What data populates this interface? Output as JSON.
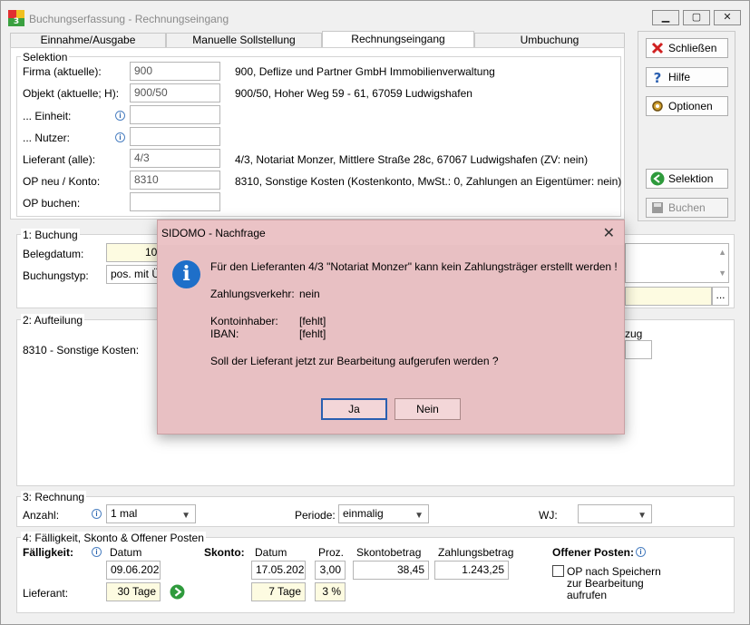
{
  "window": {
    "title": "Buchungserfassung - Rechnungseingang"
  },
  "tabs": [
    "Einnahme/Ausgabe",
    "Manuelle Sollstellung",
    "Rechnungseingang",
    "Umbuchung"
  ],
  "buttons": {
    "close": "Schließen",
    "help": "Hilfe",
    "options": "Optionen",
    "selection": "Selektion",
    "book": "Buchen"
  },
  "selektion": {
    "legend": "Selektion",
    "rows": [
      {
        "label": "Firma (aktuelle):",
        "value": "900",
        "desc": "900,  Deflize und Partner GmbH Immobilienverwaltung"
      },
      {
        "label": "Objekt (aktuelle; H):",
        "value": "900/50",
        "desc": "900/50,  Hoher Weg 59 - 61, 67059 Ludwigshafen"
      },
      {
        "label": "... Einheit:",
        "value": "",
        "desc": ""
      },
      {
        "label": "... Nutzer:",
        "value": "",
        "desc": ""
      },
      {
        "label": "Lieferant (alle):",
        "value": "4/3",
        "desc": "4/3,  Notariat Monzer,  Mittlere Straße 28c, 67067 Ludwigshafen  (ZV: nein)"
      },
      {
        "label": "OP neu / Konto:",
        "value": "8310",
        "desc": "8310,  Sonstige Kosten  (Kostenkonto,  MwSt.: 0,  Zahlungen an Eigentümer: nein)"
      },
      {
        "label": "OP buchen:",
        "value": "",
        "desc": ""
      }
    ]
  },
  "buchung": {
    "legend": "1: Buchung",
    "belegdatum_label": "Belegdatum:",
    "belegdatum_value": "10.",
    "buchungstyp_label": "Buchungstyp:",
    "buchungstyp_value": "pos. mit ÜV",
    "ellipsis": "..."
  },
  "aufteilung": {
    "legend": "2: Aufteilung",
    "row_label": "8310 - Sonstige Kosten:",
    "right_label": "zug"
  },
  "rechnung": {
    "legend": "3: Rechnung",
    "anzahl_label": "Anzahl:",
    "anzahl_value": "1 mal",
    "periode_label": "Periode:",
    "periode_value": "einmalig",
    "wj_label": "WJ:",
    "wj_value": ""
  },
  "faelligkeit": {
    "legend": "4: Fälligkeit, Skonto & Offener Posten",
    "faelligkeit_label": "Fälligkeit:",
    "datum_label": "Datum",
    "faellig_datum": "09.06.2022",
    "lieferant_label": "Lieferant:",
    "lieferant_tage": "30 Tage",
    "skonto_label": "Skonto:",
    "skonto_datum_label": "Datum",
    "skonto_datum": "17.05.2022",
    "proz_label": "Proz.",
    "proz_value": "3,00",
    "proz_pct": "3 %",
    "skonto_tage": "7 Tage",
    "skontobetrag_label": "Skontobetrag",
    "skontobetrag_value": "38,45",
    "zahlungsbetrag_label": "Zahlungsbetrag",
    "zahlungsbetrag_value": "1.243,25",
    "op_label": "Offener Posten:",
    "op_checkbox_label_1": "OP nach Speichern",
    "op_checkbox_label_2": "zur Bearbeitung",
    "op_checkbox_label_3": "aufrufen"
  },
  "dialog": {
    "title": "SIDOMO - Nachfrage",
    "message": "Für den Lieferanten 4/3 \"Notariat Monzer\" kann kein Zahlungsträger erstellt werden !",
    "zv_label": "Zahlungsverkehr:",
    "zv_value": "nein",
    "kontoinhaber_label": "Kontoinhaber:",
    "kontoinhaber_value": "[fehlt]",
    "iban_label": "IBAN:",
    "iban_value": "[fehlt]",
    "question": "Soll der Lieferant jetzt zur Bearbeitung aufgerufen werden ?",
    "yes": "Ja",
    "no": "Nein"
  },
  "colors": {
    "dialog_bg": "#ebc3c6",
    "accent": "#1e6fc9",
    "input_yellow": "#fdfbe1"
  }
}
